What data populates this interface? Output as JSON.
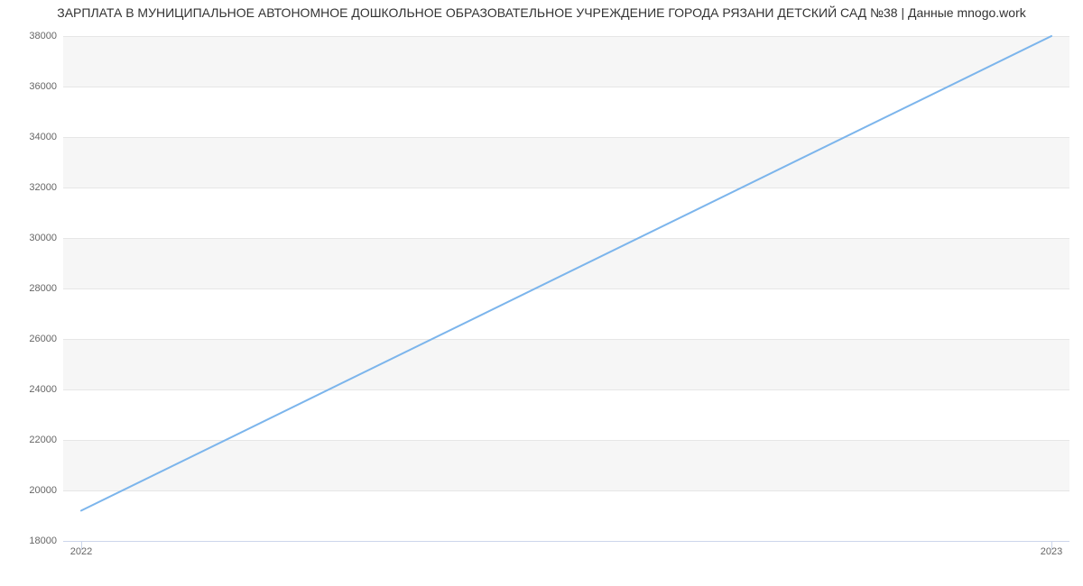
{
  "chart_data": {
    "type": "line",
    "title": "ЗАРПЛАТА В МУНИЦИПАЛЬНОЕ АВТОНОМНОЕ ДОШКОЛЬНОЕ ОБРАЗОВАТЕЛЬНОЕ УЧРЕЖДЕНИЕ  ГОРОДА РЯЗАНИ  ДЕТСКИЙ САД №38 | Данные mnogo.work",
    "xlabel": "",
    "ylabel": "",
    "x_categories": [
      "2022",
      "2023"
    ],
    "y_ticks": [
      18000,
      20000,
      22000,
      24000,
      26000,
      28000,
      30000,
      32000,
      34000,
      36000,
      38000
    ],
    "ylim": [
      18000,
      38000
    ],
    "series": [
      {
        "name": "Зарплата",
        "color": "#7cb5ec",
        "values": [
          19200,
          38000
        ]
      }
    ],
    "grid": {
      "y": true,
      "bands": true
    },
    "legend": {
      "visible": false
    }
  }
}
